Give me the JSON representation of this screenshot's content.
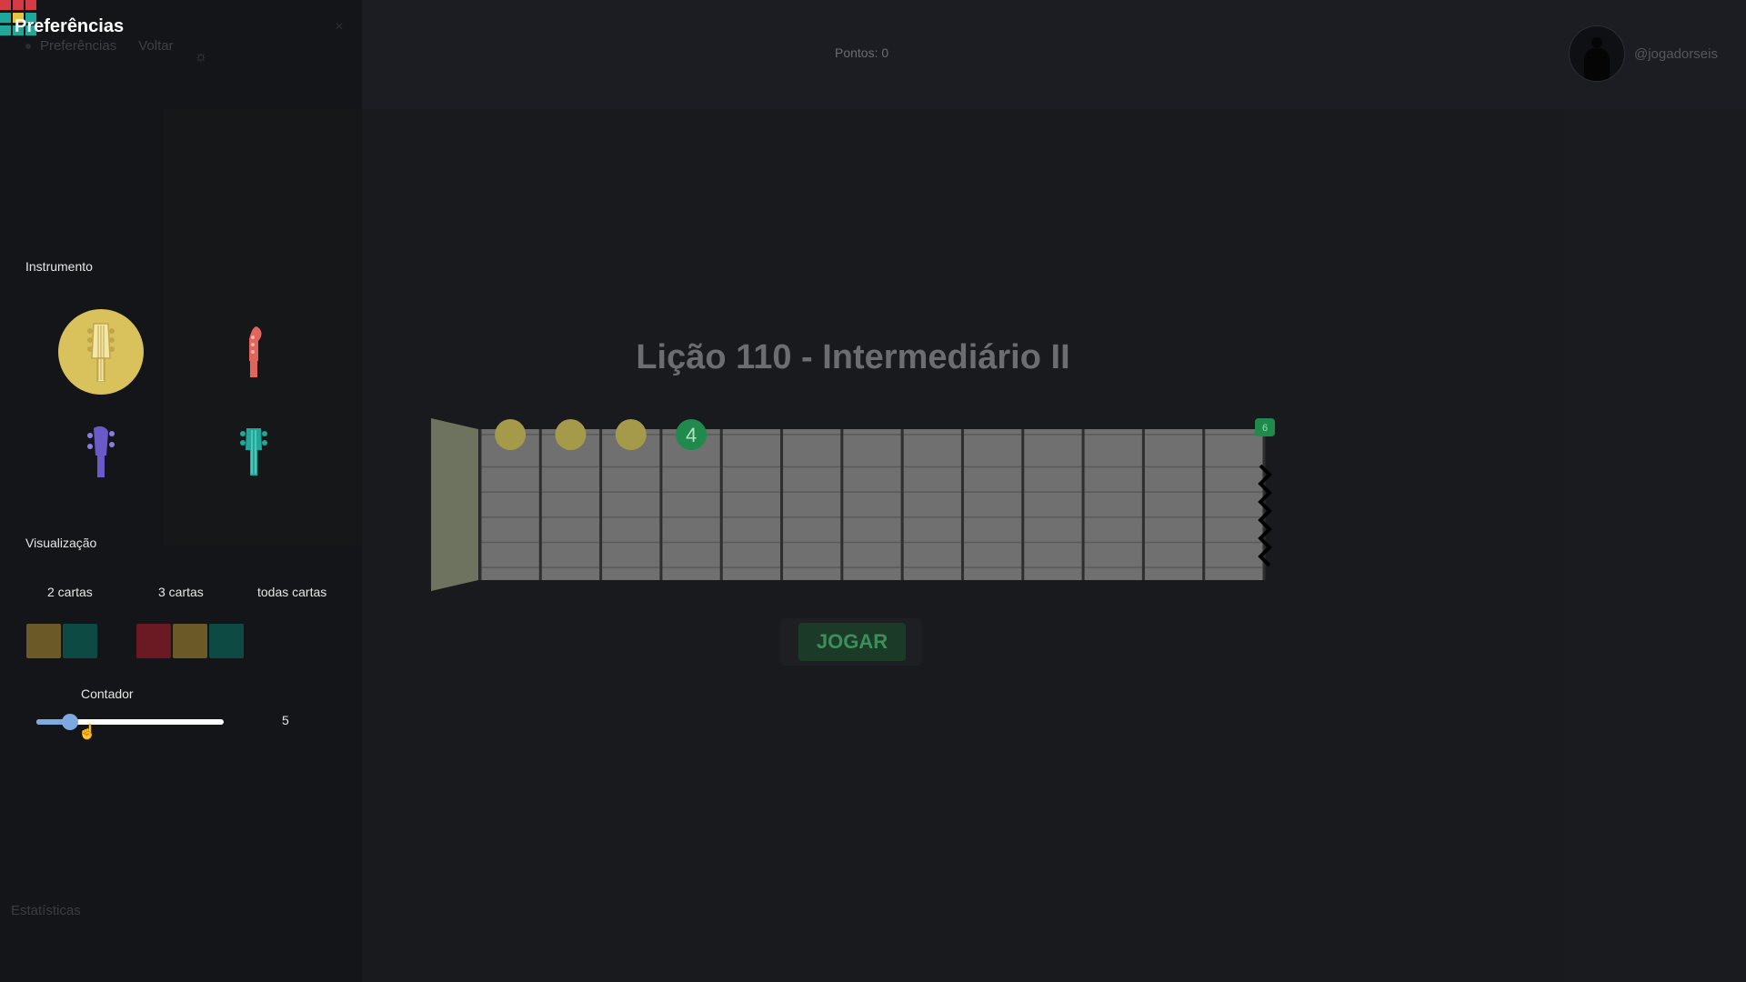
{
  "sidebar": {
    "title": "Preferências",
    "breadcrumbs": [
      "Preferências",
      "Voltar"
    ],
    "theme_icon": "sun-icon",
    "close_icon": "close-icon",
    "instrument_label": "Instrumento",
    "instruments": [
      {
        "name": "violão",
        "icon": "acoustic-guitar-headstock-icon",
        "selected": true,
        "color": "#d9c25c"
      },
      {
        "name": "guitarra",
        "icon": "electric-guitar-headstock-icon",
        "selected": false,
        "color": "#e0655d"
      },
      {
        "name": "baixo",
        "icon": "bass-headstock-icon",
        "selected": false,
        "color": "#6a5ac8"
      },
      {
        "name": "ukulele",
        "icon": "ukulele-headstock-icon",
        "selected": false,
        "color": "#1fa89a"
      }
    ],
    "visualization_label": "Visualização",
    "card_options": [
      {
        "label": "2 cartas",
        "colors": [
          "#6b5a28",
          "#0d4a44"
        ]
      },
      {
        "label": "3 cartas",
        "colors": [
          "#6b1a24",
          "#6b5a28",
          "#0d4a44"
        ]
      },
      {
        "label": "todas cartas",
        "colors": [
          "#d63a44",
          "#d63a44",
          "#d63a44",
          "#1fa89a",
          "#e8c243",
          "#1fa89a",
          "#1fa89a",
          "#1fa89a",
          "#1fa89a"
        ]
      }
    ],
    "counter_label": "Contador",
    "counter_value": "5",
    "counter_fraction": 0.18,
    "statistics_label": "Estatísticas"
  },
  "header": {
    "points": "Pontos: 0",
    "username": "@jogadorseis",
    "avatar_icon": "guitar-player-avatar-icon"
  },
  "lesson": {
    "title": "Lição 110 - Intermediário II",
    "play_label": "JOGAR"
  },
  "fretboard": {
    "fret_count": 13,
    "string_count": 6,
    "markers": [
      {
        "fret": 1,
        "string": 1,
        "label": "",
        "color": "#a59a49"
      },
      {
        "fret": 2,
        "string": 1,
        "label": "",
        "color": "#a59a49"
      },
      {
        "fret": 3,
        "string": 1,
        "label": "",
        "color": "#a59a49"
      },
      {
        "fret": 4,
        "string": 1,
        "label": "4",
        "color": "#1f8a4c"
      }
    ],
    "end_badge": "6",
    "end_badge_color": "#1f8a4c"
  },
  "colors": {
    "accent": "#7ea9e0",
    "selected_instrument": "#d9c25c",
    "play_button": "#1c3a28"
  }
}
